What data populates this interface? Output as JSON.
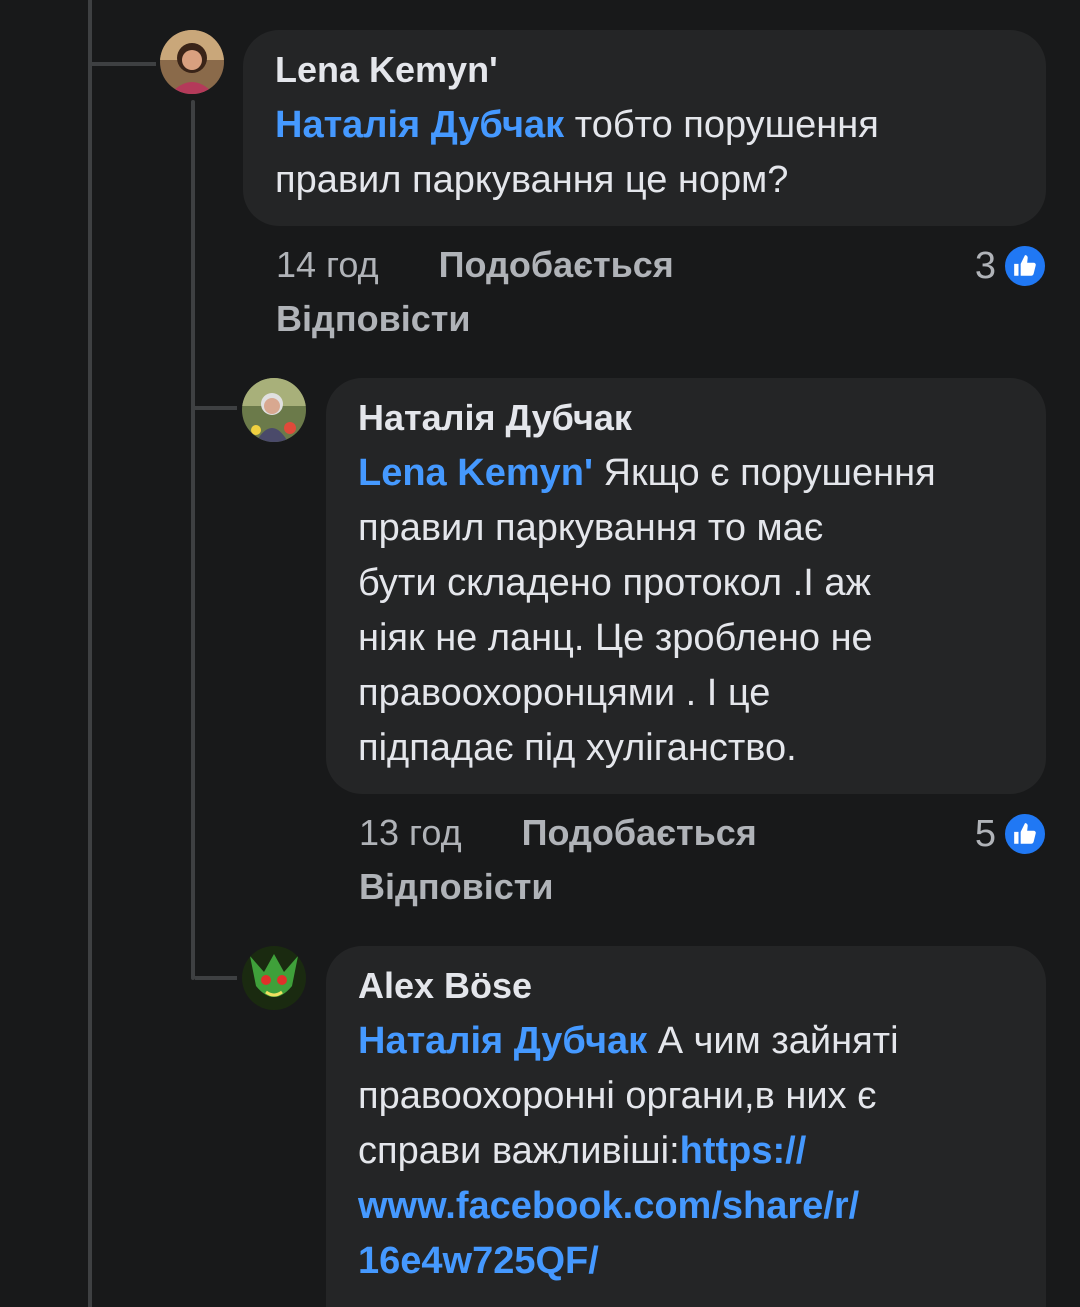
{
  "comments": [
    {
      "author": "Lena Kemyn'",
      "mention": "Наталія Дубчак",
      "text_line1": " тобто порушення",
      "text_rest": "правил паркування це норм?",
      "time": "14 год",
      "like_label": "Подобається",
      "reply_label": "Відповісти",
      "reaction_count": "3"
    },
    {
      "author": "Наталія Дубчак",
      "mention": "Lena Kemyn'",
      "text_line1": " Якщо є порушення",
      "text_rest": "правил паркування  то має\nбути складено протокол .І аж\nніяк не  ланц. Це зроблено не\nправоохоронцями . І це\nпідпадає під хуліганство.",
      "time": "13 год",
      "like_label": "Подобається",
      "reply_label": "Відповісти",
      "reaction_count": "5"
    },
    {
      "author": "Alex Böse",
      "mention": "Наталія Дубчак",
      "text_line1": " А чим зайняті",
      "text_rest": "правоохоронні органи,в них є\nсправи важливіші:",
      "link_line1": "https://",
      "link_line2": "www.facebook.com/share/r/",
      "link_line3": "16e4w725QF/"
    }
  ],
  "colors": {
    "background": "#18191a",
    "bubble": "#242526",
    "mention": "#4599ff",
    "meta_text": "#b0b3b8",
    "like_icon": "#2078f4"
  }
}
